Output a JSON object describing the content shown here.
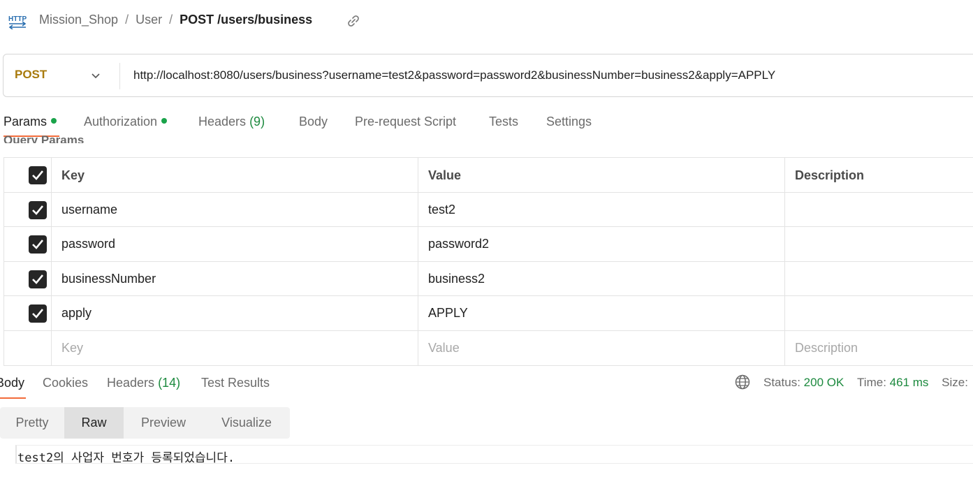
{
  "breadcrumb": {
    "icon": "http-icon",
    "items": [
      "Mission_Shop",
      "User"
    ],
    "current": "POST /users/business"
  },
  "request": {
    "method": "POST",
    "url": "http://localhost:8080/users/business?username=test2&password=password2&businessNumber=business2&apply=APPLY"
  },
  "request_tabs": {
    "params": "Params",
    "authorization": "Authorization",
    "headers": "Headers",
    "headers_count": "(9)",
    "body": "Body",
    "prerequest": "Pre-request Script",
    "tests": "Tests",
    "settings": "Settings"
  },
  "query_params": {
    "title": "Query Params",
    "columns": [
      "Key",
      "Value",
      "Description"
    ],
    "rows": [
      {
        "key": "username",
        "value": "test2",
        "description": ""
      },
      {
        "key": "password",
        "value": "password2",
        "description": ""
      },
      {
        "key": "businessNumber",
        "value": "business2",
        "description": ""
      },
      {
        "key": "apply",
        "value": "APPLY",
        "description": ""
      }
    ],
    "placeholder": {
      "key": "Key",
      "value": "Value",
      "description": "Description"
    }
  },
  "response_tabs": {
    "body": "Body",
    "cookies": "Cookies",
    "headers": "Headers",
    "headers_count": "(14)",
    "test_results": "Test Results"
  },
  "response_status": {
    "status_label": "Status:",
    "status_value": "200 OK",
    "time_label": "Time:",
    "time_value": "461 ms",
    "size_label": "Size:"
  },
  "view_modes": [
    "Pretty",
    "Raw",
    "Preview",
    "Visualize"
  ],
  "response_body": "test2의 사업자 번호가 등록되었습니다.",
  "colors": {
    "method": "#a87a0c",
    "active_underline": "#f26b3a",
    "success": "#1d8a3f"
  }
}
